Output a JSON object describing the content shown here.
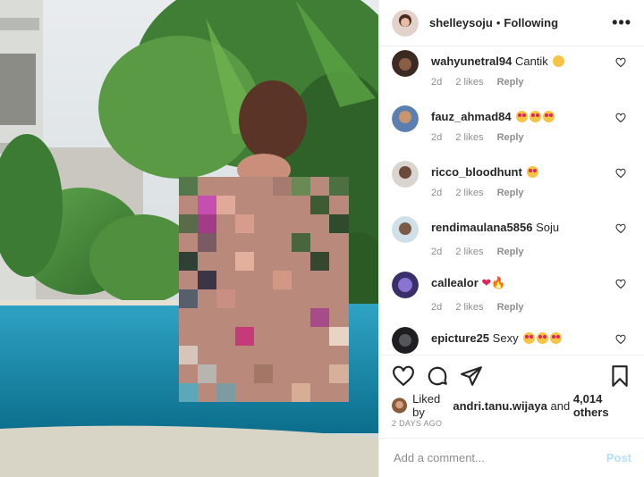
{
  "post": {
    "username": "shelleysoju",
    "separator": "•",
    "follow_status": "Following",
    "more_label": "•••"
  },
  "comments": [
    {
      "user": "wahyunetral94",
      "text": "Cantik",
      "emoji": [
        "smile"
      ],
      "age": "2d",
      "likes": "2 likes",
      "reply": "Reply"
    },
    {
      "user": "fauz_ahmad84",
      "text": "",
      "emoji": [
        "love",
        "love",
        "love"
      ],
      "age": "2d",
      "likes": "2 likes",
      "reply": "Reply"
    },
    {
      "user": "ricco_bloodhunt",
      "text": "",
      "emoji": [
        "love"
      ],
      "age": "2d",
      "likes": "2 likes",
      "reply": "Reply"
    },
    {
      "user": "rendimaulana5856",
      "text": "Soju",
      "emoji": [],
      "age": "2d",
      "likes": "2 likes",
      "reply": "Reply"
    },
    {
      "user": "callealor",
      "text": "",
      "emoji": [
        "heart",
        "fire"
      ],
      "age": "2d",
      "likes": "2 likes",
      "reply": "Reply"
    },
    {
      "user": "epicture25",
      "text": "Sexy",
      "emoji": [
        "love",
        "love",
        "love"
      ],
      "age": "",
      "likes": "",
      "reply": ""
    }
  ],
  "likes_line": {
    "prefix": "Liked by",
    "liker": "andri.tanu.wijaya",
    "conj": "and",
    "others": "4,014 others"
  },
  "timestamp": "2 DAYS AGO",
  "comment_box": {
    "placeholder": "Add a comment...",
    "post_label": "Post"
  },
  "colors": {
    "link_blue_disabled": "#b2dffc",
    "meta_gray": "#8e8e8e",
    "text_dark": "#262626"
  },
  "icons": {
    "like": "heart-outline-icon",
    "comment": "speech-bubble-icon",
    "share": "paper-plane-icon",
    "save": "bookmark-icon"
  }
}
